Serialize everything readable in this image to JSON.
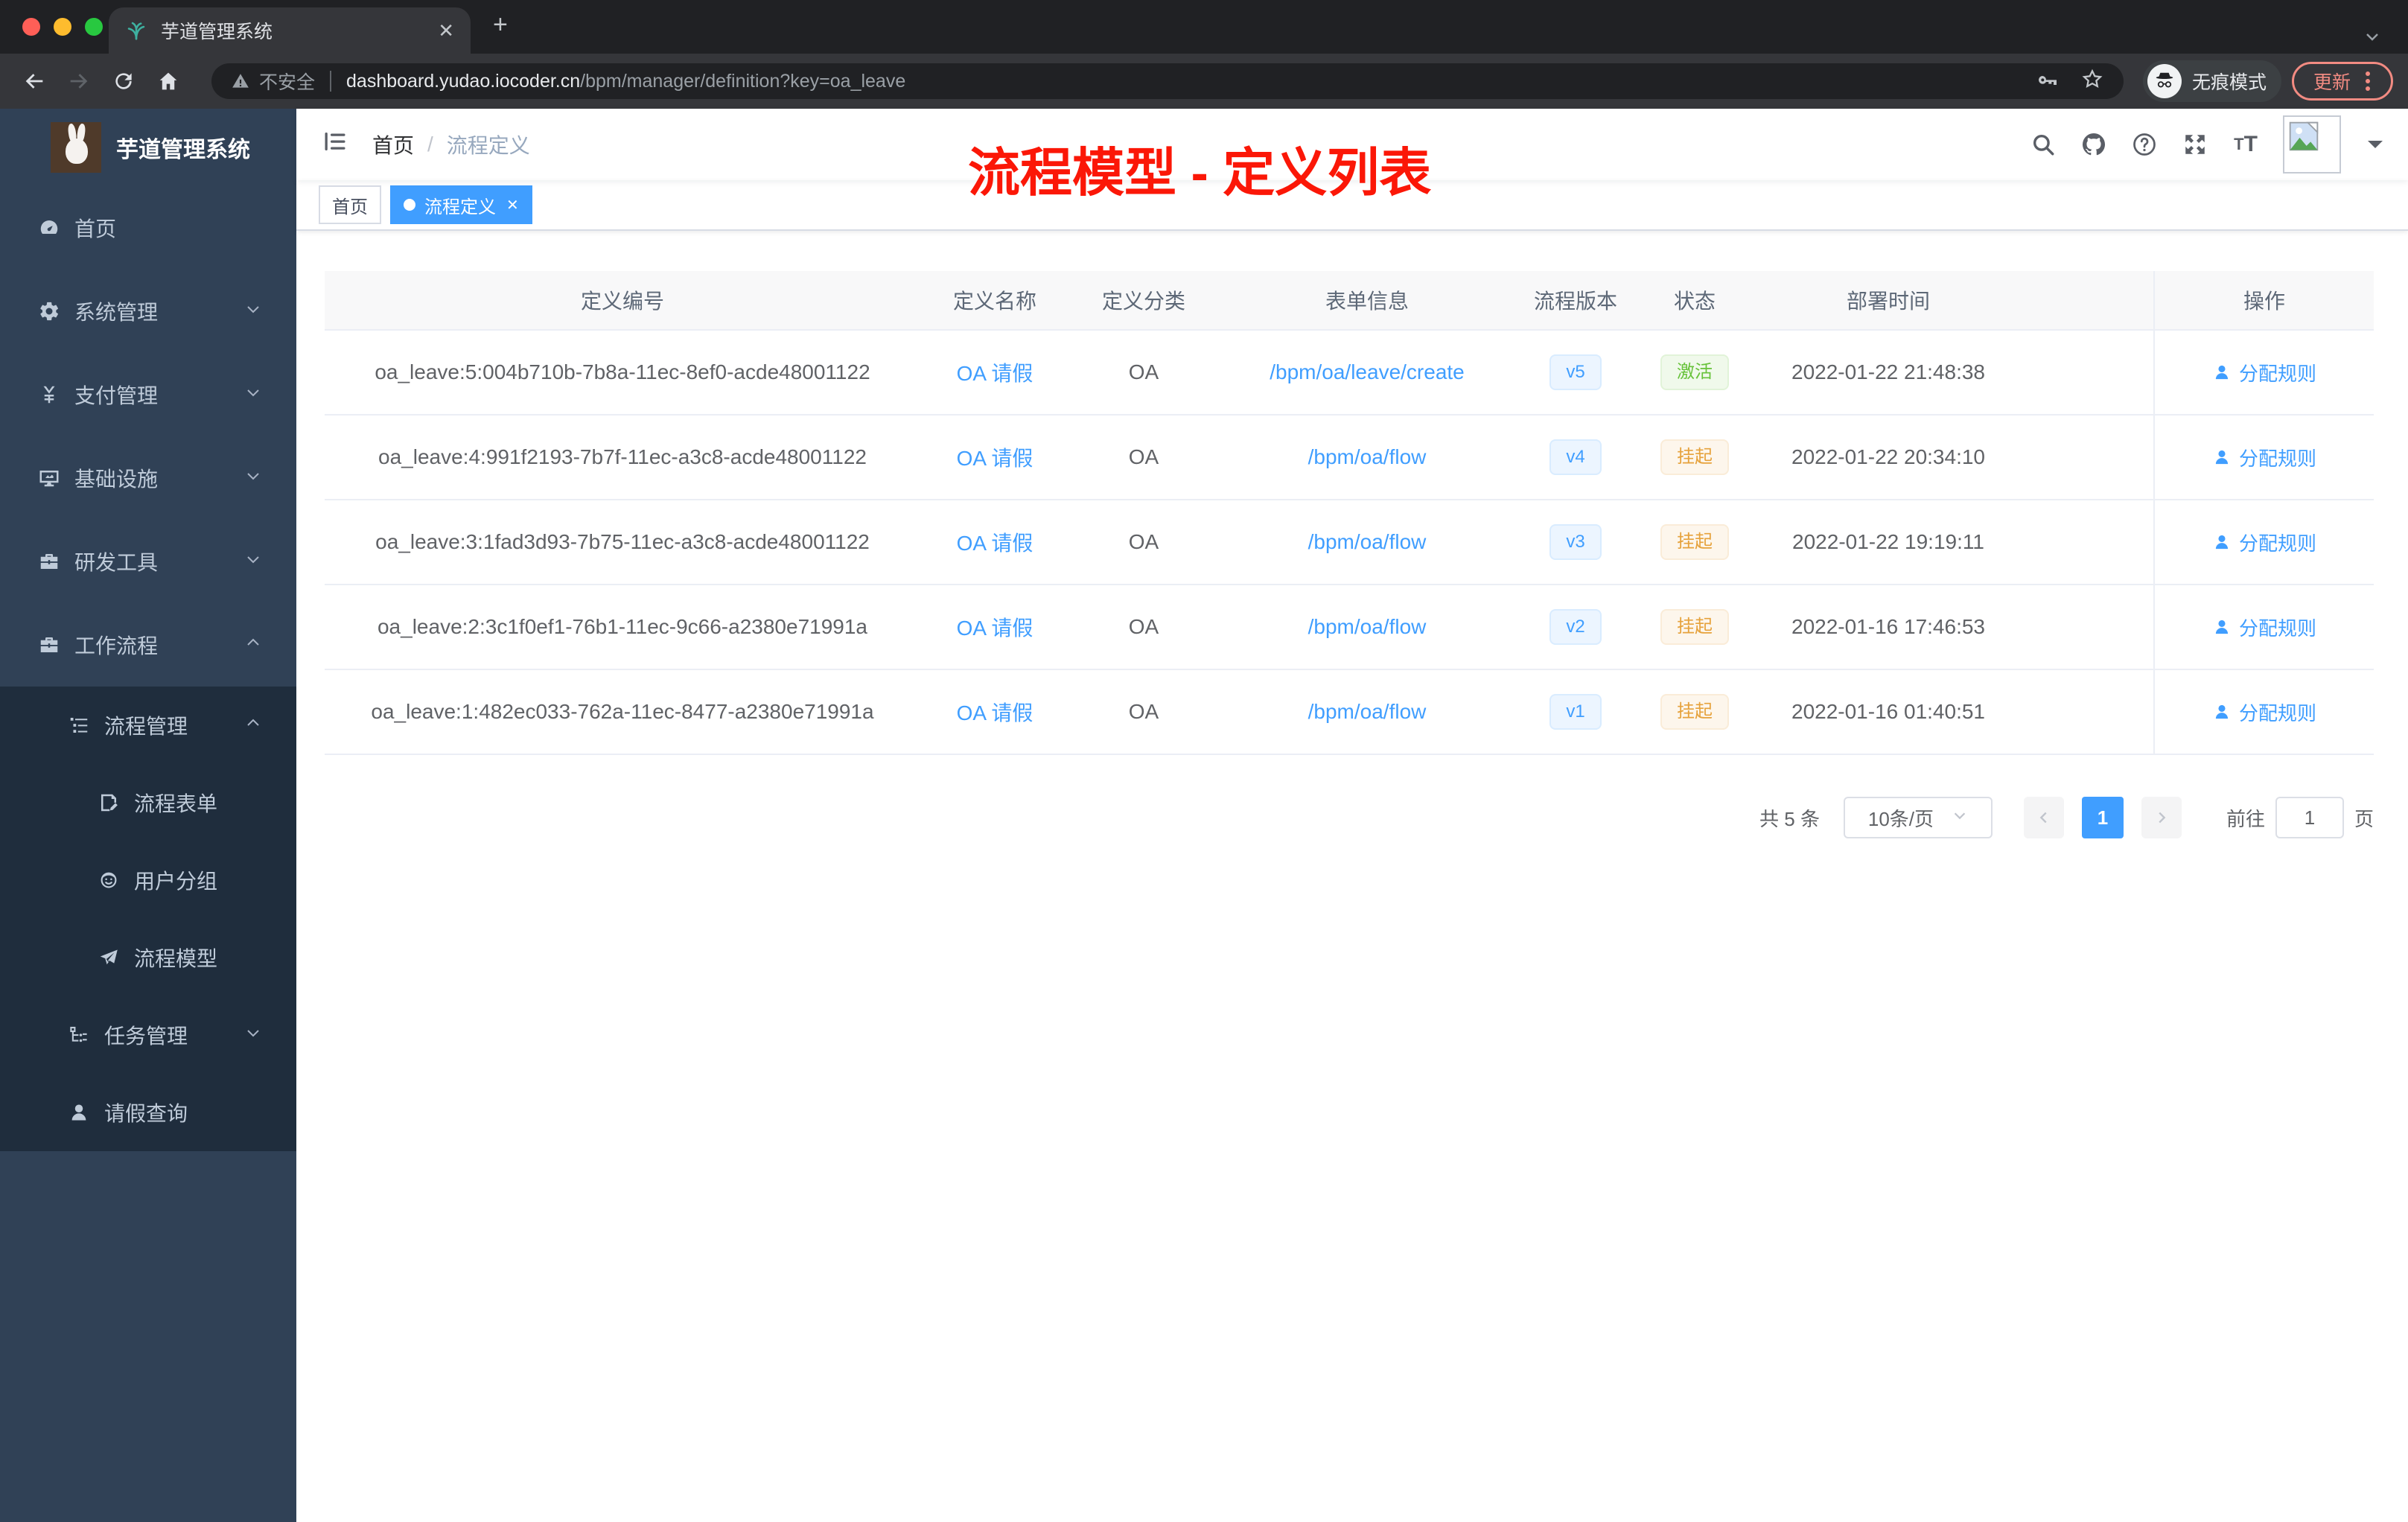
{
  "browser": {
    "tab_title": "芋道管理系统",
    "address": {
      "security_label": "不安全",
      "url_host": "dashboard.yudao.iocoder.cn",
      "url_path": "/bpm/manager/definition?key=oa_leave"
    },
    "incognito_label": "无痕模式",
    "update_label": "更新"
  },
  "sidebar": {
    "logo_title": "芋道管理系统",
    "items": [
      {
        "label": "首页",
        "icon": "dashboard",
        "level": 1
      },
      {
        "label": "系统管理",
        "icon": "gear",
        "level": 1,
        "chevron": "down"
      },
      {
        "label": "支付管理",
        "icon": "yen",
        "level": 1,
        "chevron": "down"
      },
      {
        "label": "基础设施",
        "icon": "monitor",
        "level": 1,
        "chevron": "down"
      },
      {
        "label": "研发工具",
        "icon": "toolbox",
        "level": 1,
        "chevron": "down"
      },
      {
        "label": "工作流程",
        "icon": "briefcase",
        "level": 1,
        "chevron": "up"
      },
      {
        "label": "流程管理",
        "icon": "tree-table",
        "level": 2,
        "chevron": "up"
      },
      {
        "label": "流程表单",
        "icon": "form",
        "level": 3
      },
      {
        "label": "用户分组",
        "icon": "group",
        "level": 3
      },
      {
        "label": "流程模型",
        "icon": "send",
        "level": 3
      },
      {
        "label": "任务管理",
        "icon": "tree",
        "level": 2,
        "chevron": "down"
      },
      {
        "label": "请假查询",
        "icon": "user",
        "level": 2
      }
    ]
  },
  "header": {
    "breadcrumb": {
      "home": "首页",
      "current": "流程定义"
    },
    "annotation": "流程模型 - 定义列表"
  },
  "tags": [
    {
      "label": "首页",
      "active": false,
      "closable": false
    },
    {
      "label": "流程定义",
      "active": true,
      "closable": true
    }
  ],
  "table": {
    "columns": [
      "定义编号",
      "定义名称",
      "定义分类",
      "表单信息",
      "流程版本",
      "状态",
      "部署时间",
      "操作"
    ],
    "rows": [
      {
        "id": "oa_leave:5:004b710b-7b8a-11ec-8ef0-acde48001122",
        "name": "OA 请假",
        "category": "OA",
        "form": "/bpm/oa/leave/create",
        "version": "v5",
        "status": "激活",
        "status_type": "success",
        "deploy_time": "2022-01-22 21:48:38",
        "action": "分配规则"
      },
      {
        "id": "oa_leave:4:991f2193-7b7f-11ec-a3c8-acde48001122",
        "name": "OA 请假",
        "category": "OA",
        "form": "/bpm/oa/flow",
        "version": "v4",
        "status": "挂起",
        "status_type": "warning",
        "deploy_time": "2022-01-22 20:34:10",
        "action": "分配规则"
      },
      {
        "id": "oa_leave:3:1fad3d93-7b75-11ec-a3c8-acde48001122",
        "name": "OA 请假",
        "category": "OA",
        "form": "/bpm/oa/flow",
        "version": "v3",
        "status": "挂起",
        "status_type": "warning",
        "deploy_time": "2022-01-22 19:19:11",
        "action": "分配规则"
      },
      {
        "id": "oa_leave:2:3c1f0ef1-76b1-11ec-9c66-a2380e71991a",
        "name": "OA 请假",
        "category": "OA",
        "form": "/bpm/oa/flow",
        "version": "v2",
        "status": "挂起",
        "status_type": "warning",
        "deploy_time": "2022-01-16 17:46:53",
        "action": "分配规则"
      },
      {
        "id": "oa_leave:1:482ec033-762a-11ec-8477-a2380e71991a",
        "name": "OA 请假",
        "category": "OA",
        "form": "/bpm/oa/flow",
        "version": "v1",
        "status": "挂起",
        "status_type": "warning",
        "deploy_time": "2022-01-16 01:40:51",
        "action": "分配规则"
      }
    ]
  },
  "pagination": {
    "total": "共 5 条",
    "page_size": "10条/页",
    "current_page": "1",
    "goto_label": "前往",
    "page_unit": "页"
  },
  "colors": {
    "accent": "#409eff",
    "success": "#67c23a",
    "warning": "#e6a23c",
    "sidebar_bg": "#304156",
    "submenu_bg": "#1f2d3d",
    "annotation": "#fb1707"
  }
}
